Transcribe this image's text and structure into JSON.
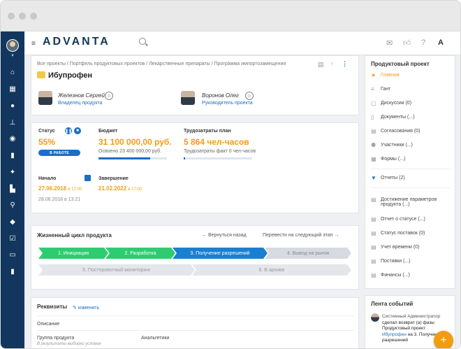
{
  "topbar": {
    "logo": "ADVANTA",
    "icons": [
      "menu-icon",
      "search-icon",
      "mail-icon",
      "thumbs-up-icon",
      "help-icon",
      "font-icon"
    ]
  },
  "sidebar": {
    "icons": [
      "home-icon",
      "calendar-icon",
      "users-icon",
      "hierarchy-icon",
      "target-icon",
      "chart-icon",
      "sparkle-icon",
      "shoe-icon",
      "runner-icon",
      "cube-icon",
      "checklist-icon",
      "window-icon",
      "bookmark-icon"
    ]
  },
  "header": {
    "breadcrumb": "Все проекты / Портфель продуктовых проектов / Лекарственные препараты / Программа импортозамещения",
    "title": "Ибупрофен",
    "people": [
      {
        "name": "Железнов Сергей",
        "role": "Владелец продукта"
      },
      {
        "name": "Воронов Олег",
        "role": "Руководитель проекта"
      }
    ]
  },
  "stats": {
    "status_label": "Статус",
    "status_value": "55%",
    "status_pill": "В РАБОТЕ",
    "budget_label": "Бюджет",
    "budget_value": "31 100 000,00 руб.",
    "budget_spent": "Освоено  23 400 000,00 руб.",
    "budget_progress": 0.75,
    "labor_label": "Трудозатраты план",
    "labor_value": "5 864 чел-часов",
    "labor_fact": "Трудозатраты факт  0 чел-часов",
    "labor_progress": 0.0,
    "start_label": "Начало",
    "start_date": "27.06.2018",
    "start_time": "в 17:00",
    "start_note": "28.06.2018 в 13:21",
    "end_label": "Завершение",
    "end_date": "21.02.2022",
    "end_time": "в 17:00"
  },
  "lifecycle": {
    "title": "Жизненный цикл продукта",
    "back": "Вернуться назад",
    "next": "Перевести на следующий этап",
    "stages_row1": [
      {
        "label": "1. Инициация",
        "color": "#2ecc71"
      },
      {
        "label": "2. Разработка",
        "color": "#2ecc71"
      },
      {
        "label": "3. Получение разрешений",
        "color": "#1a7fd1"
      },
      {
        "label": "4. Вывод на рынок",
        "color": "#d6dbe1"
      }
    ],
    "stages_row2": [
      {
        "label": "5. Постпроектный мониторинг",
        "color": "#d6dbe1"
      },
      {
        "label": "6. В архиве",
        "color": "#d6dbe1"
      }
    ]
  },
  "requisites": {
    "title": "Реквизиты",
    "edit": "изменить",
    "rows": [
      {
        "label": "Описание"
      },
      {
        "label": "Группа продукта",
        "hint": "В результаты выборки условие",
        "value": "Анальгетики"
      }
    ]
  },
  "right_panel": {
    "title": "Продуктовый проект",
    "items": [
      {
        "icon": "star-icon",
        "label": "Главная",
        "active": true
      },
      {
        "icon": "gantt-icon",
        "label": "Гант"
      },
      {
        "icon": "chat-icon",
        "label": "Дискуссии (0)"
      },
      {
        "icon": "document-icon",
        "label": "Документы (...)"
      },
      {
        "icon": "approval-icon",
        "label": "Согласования (0)"
      },
      {
        "icon": "group-icon",
        "label": "Участники (...)"
      },
      {
        "icon": "form-icon",
        "label": "Формы (...)"
      }
    ],
    "reports_label": "Отчеты (2)",
    "reports": [
      {
        "icon": "report-icon",
        "label": "Достижение параметров продукта (...)"
      },
      {
        "icon": "report-icon",
        "label": "Отчет о статусе (...)"
      },
      {
        "icon": "report-icon",
        "label": "Статус поставок (0)"
      },
      {
        "icon": "report-icon",
        "label": "Учет времени (0)"
      },
      {
        "icon": "report-icon",
        "label": "Поставки (...)"
      },
      {
        "icon": "report-icon",
        "label": "Финансы (...)"
      }
    ]
  },
  "feed": {
    "title": "Лента событий",
    "author": "Системный Администратор",
    "line1": "сделал возврат (а) фазы",
    "line2": "Продуктовый проект",
    "link": "Ибупрофен",
    "line3": "на 3. Получение",
    "line4": "разрешений"
  }
}
